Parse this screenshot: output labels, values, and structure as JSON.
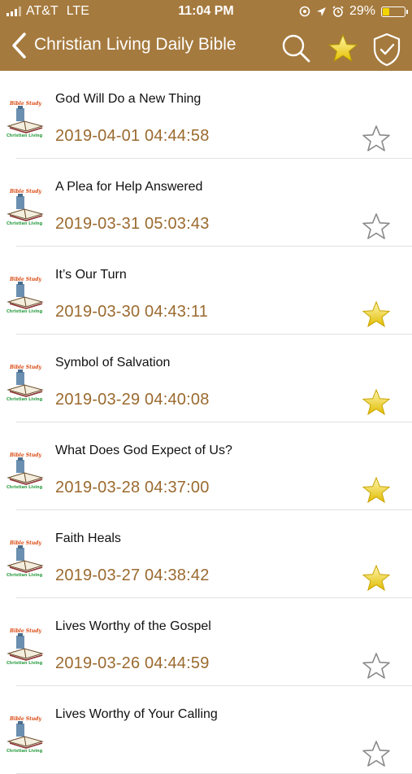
{
  "status_bar": {
    "carrier": "AT&T",
    "network": "LTE",
    "time": "11:04 PM",
    "battery": "29%"
  },
  "header": {
    "title": "Christian Living Daily Bible",
    "color": "#a57a3e"
  },
  "thumb": {
    "top_text": "Bible Study",
    "bottom_text": "Christian Living"
  },
  "articles": [
    {
      "title": "God Will Do a New Thing",
      "date": "2019-04-01 04:44:58",
      "starred": false
    },
    {
      "title": "A Plea for Help Answered",
      "date": "2019-03-31 05:03:43",
      "starred": false
    },
    {
      "title": "It’s Our Turn",
      "date": "2019-03-30 04:43:11",
      "starred": true
    },
    {
      "title": "Symbol of Salvation",
      "date": "2019-03-29 04:40:08",
      "starred": true
    },
    {
      "title": "What Does God Expect of Us?",
      "date": "2019-03-28 04:37:00",
      "starred": true
    },
    {
      "title": "Faith Heals",
      "date": "2019-03-27 04:38:42",
      "starred": true
    },
    {
      "title": "Lives Worthy of the Gospel",
      "date": "2019-03-26 04:44:59",
      "starred": false
    },
    {
      "title": "Lives Worthy of Your Calling",
      "date": "",
      "starred": false
    }
  ]
}
